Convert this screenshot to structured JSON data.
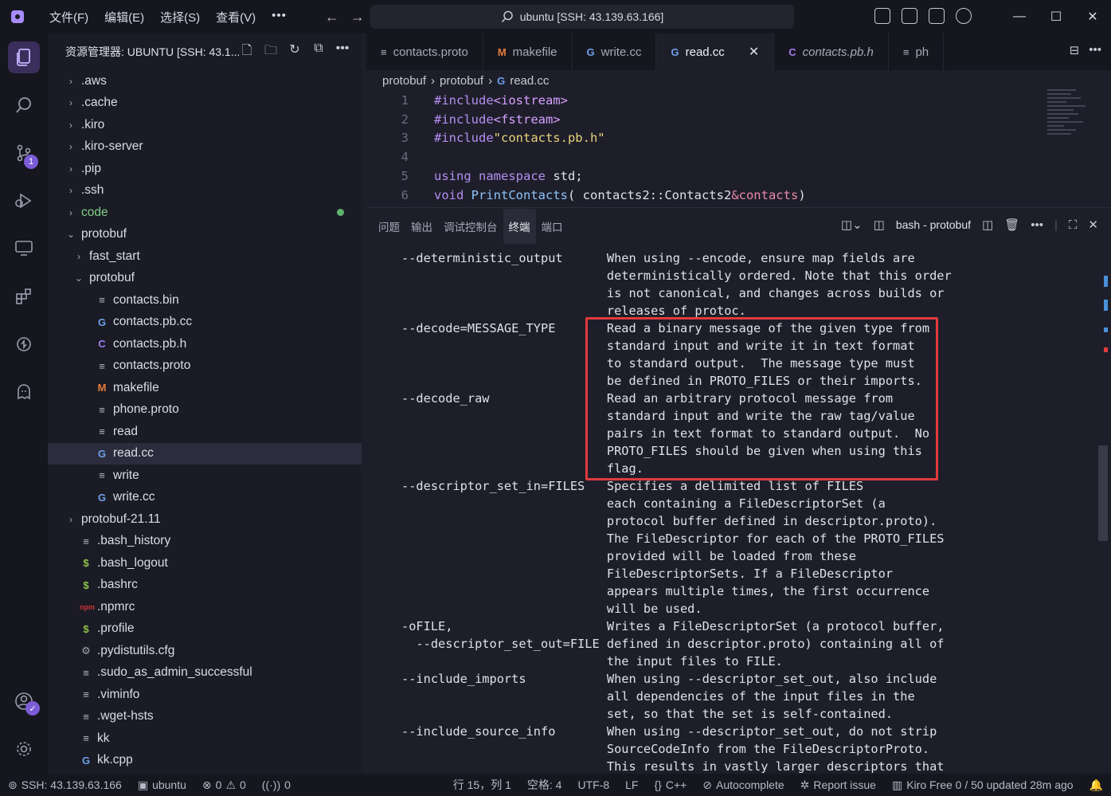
{
  "titlebar": {
    "menu": [
      "文件(F)",
      "编辑(E)",
      "选择(S)",
      "查看(V)",
      "•••"
    ],
    "search": "ubuntu [SSH: 43.139.63.166]"
  },
  "activity": {
    "scm_badge": "1"
  },
  "sidebar": {
    "title": "资源管理器: UBUNTU [SSH: 43.1...",
    "tree": [
      {
        "label": ".aws",
        "type": "folder",
        "depth": 0
      },
      {
        "label": ".cache",
        "type": "folder",
        "depth": 0
      },
      {
        "label": ".kiro",
        "type": "folder",
        "depth": 0
      },
      {
        "label": ".kiro-server",
        "type": "folder",
        "depth": 0
      },
      {
        "label": ".pip",
        "type": "folder",
        "depth": 0
      },
      {
        "label": ".ssh",
        "type": "folder",
        "depth": 0
      },
      {
        "label": "code",
        "type": "folder",
        "depth": 0,
        "dot": true
      },
      {
        "label": "protobuf",
        "type": "folder-open",
        "depth": 0
      },
      {
        "label": "fast_start",
        "type": "folder",
        "depth": 1
      },
      {
        "label": "protobuf",
        "type": "folder-open",
        "depth": 1
      },
      {
        "label": "contacts.bin",
        "type": "lines",
        "depth": 2
      },
      {
        "label": "contacts.pb.cc",
        "type": "cpp",
        "depth": 2
      },
      {
        "label": "contacts.pb.h",
        "type": "h",
        "depth": 2
      },
      {
        "label": "contacts.proto",
        "type": "lines",
        "depth": 2
      },
      {
        "label": "makefile",
        "type": "m",
        "depth": 2
      },
      {
        "label": "phone.proto",
        "type": "lines",
        "depth": 2
      },
      {
        "label": "read",
        "type": "lines",
        "depth": 2
      },
      {
        "label": "read.cc",
        "type": "cpp",
        "depth": 2,
        "selected": true
      },
      {
        "label": "write",
        "type": "lines",
        "depth": 2
      },
      {
        "label": "write.cc",
        "type": "cpp",
        "depth": 2
      },
      {
        "label": "protobuf-21.11",
        "type": "folder",
        "depth": 0
      },
      {
        "label": ".bash_history",
        "type": "lines",
        "depth": 0
      },
      {
        "label": ".bash_logout",
        "type": "dollar",
        "depth": 0
      },
      {
        "label": ".bashrc",
        "type": "dollar",
        "depth": 0
      },
      {
        "label": ".npmrc",
        "type": "npm",
        "depth": 0
      },
      {
        "label": ".profile",
        "type": "dollar",
        "depth": 0
      },
      {
        "label": ".pydistutils.cfg",
        "type": "gear",
        "depth": 0
      },
      {
        "label": ".sudo_as_admin_successful",
        "type": "lines",
        "depth": 0
      },
      {
        "label": ".viminfo",
        "type": "lines",
        "depth": 0
      },
      {
        "label": ".wget-hsts",
        "type": "lines",
        "depth": 0
      },
      {
        "label": "kk",
        "type": "lines",
        "depth": 0
      },
      {
        "label": "kk.cpp",
        "type": "cpp",
        "depth": 0
      }
    ]
  },
  "editor": {
    "tabs": [
      {
        "label": "contacts.proto",
        "icon": "lines"
      },
      {
        "label": "makefile",
        "icon": "m"
      },
      {
        "label": "write.cc",
        "icon": "cpp"
      },
      {
        "label": "read.cc",
        "icon": "cpp",
        "active": true
      },
      {
        "label": "contacts.pb.h",
        "icon": "h",
        "italic": true
      },
      {
        "label": "ph",
        "icon": "lines"
      }
    ],
    "breadcrumb": [
      "protobuf",
      "protobuf",
      "read.cc"
    ],
    "lines": [
      {
        "n": "1"
      },
      {
        "n": "2"
      },
      {
        "n": "3"
      },
      {
        "n": "4"
      },
      {
        "n": "5"
      },
      {
        "n": "6"
      }
    ],
    "code": {
      "l1_pre": "#include",
      "l1_inc": "<iostream>",
      "l2_pre": "#include",
      "l2_inc": "<fstream>",
      "l3_pre": "#include",
      "l3_str": "\"contacts.pb.h\"",
      "l5_kw1": "using",
      "l5_kw2": "namespace",
      "l5_rest": " std;",
      "l6_kw": "void",
      "l6_fn": "PrintContacts",
      "l6_a": "( contacts2::Contacts2",
      "l6_b": "&contacts",
      "l6_c": ")"
    }
  },
  "panel": {
    "tabs": [
      "问题",
      "输出",
      "调试控制台",
      "终端",
      "端口"
    ],
    "active_tab": "终端",
    "terminal_name": "bash - protobuf",
    "terminal_lines": [
      "--deterministic_output      When using --encode, ensure map fields are",
      "                            deterministically ordered. Note that this order",
      "                            is not canonical, and changes across builds or",
      "                            releases of protoc.",
      "--decode=MESSAGE_TYPE       Read a binary message of the given type from",
      "                            standard input and write it in text format",
      "                            to standard output.  The message type must",
      "                            be defined in PROTO_FILES or their imports.",
      "--decode_raw                Read an arbitrary protocol message from",
      "                            standard input and write the raw tag/value",
      "                            pairs in text format to standard output.  No",
      "                            PROTO_FILES should be given when using this",
      "                            flag.",
      "--descriptor_set_in=FILES   Specifies a delimited list of FILES",
      "                            each containing a FileDescriptorSet (a",
      "                            protocol buffer defined in descriptor.proto).",
      "                            The FileDescriptor for each of the PROTO_FILES",
      "                            provided will be loaded from these",
      "                            FileDescriptorSets. If a FileDescriptor",
      "                            appears multiple times, the first occurrence",
      "                            will be used.",
      "-oFILE,                     Writes a FileDescriptorSet (a protocol buffer,",
      "  --descriptor_set_out=FILE defined in descriptor.proto) containing all of",
      "                            the input files to FILE.",
      "--include_imports           When using --descriptor_set_out, also include",
      "                            all dependencies of the input files in the",
      "                            set, so that the set is self-contained.",
      "--include_source_info       When using --descriptor_set_out, do not strip",
      "                            SourceCodeInfo from the FileDescriptorProto.",
      "                            This results in vastly larger descriptors that"
    ]
  },
  "statusbar": {
    "remote": "SSH: 43.139.63.166",
    "folder": "ubuntu",
    "errors": "0",
    "warnings": "0",
    "ports": "0",
    "position": "行 15，列 1",
    "spaces": "空格: 4",
    "encoding": "UTF-8",
    "eol": "LF",
    "language": "C++",
    "autocomplete": "Autocomplete",
    "report": "Report issue",
    "plan": "Kiro Free 0 / 50 updated 28m ago"
  },
  "colors": {
    "accent": "#7c5cd6",
    "highlight_border": "#e03b3b"
  }
}
